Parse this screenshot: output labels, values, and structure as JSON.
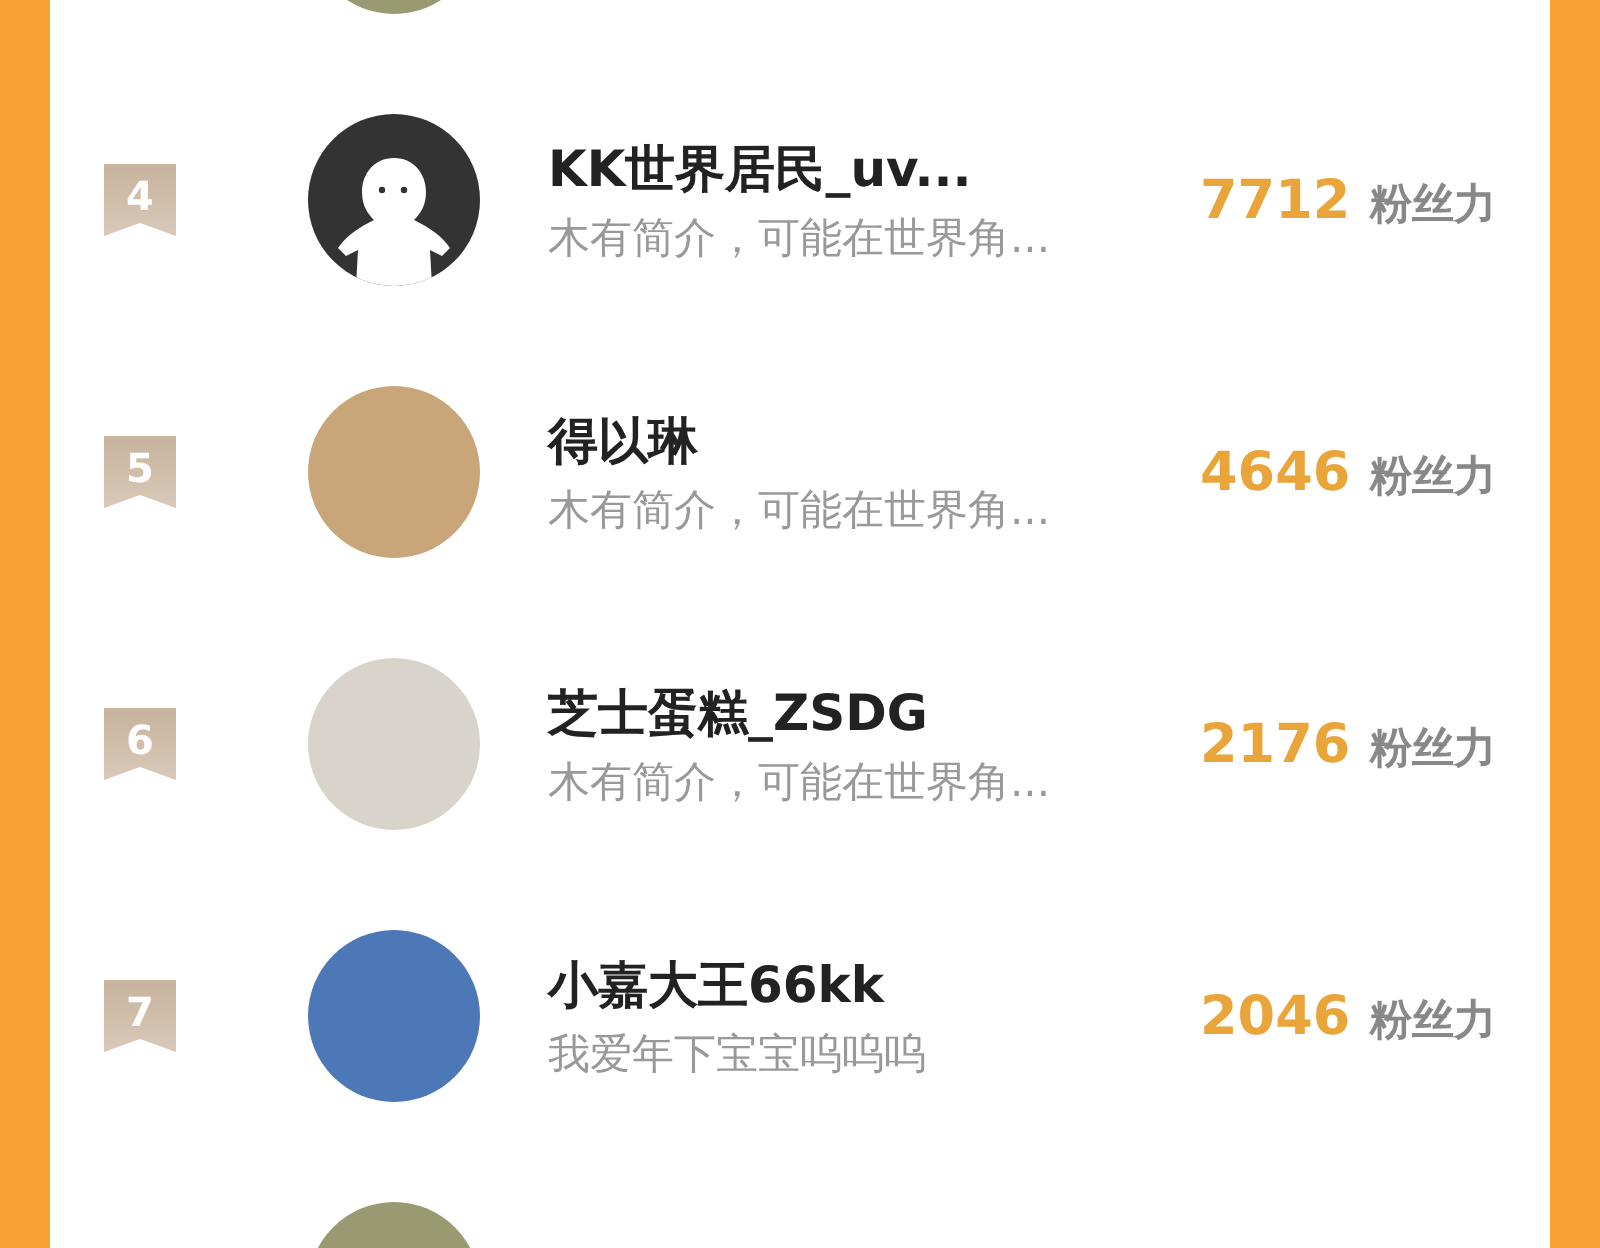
{
  "ranking": [
    {
      "kind": "partial_top",
      "default_avatar": false
    },
    {
      "kind": "full",
      "rank": "4",
      "default_avatar": true,
      "name": "KK世界居民_uv...",
      "bio": "木有简介，可能在世界角...",
      "fans": "7712",
      "fans_label": "粉丝力"
    },
    {
      "kind": "full",
      "rank": "5",
      "default_avatar": false,
      "name": "得以琳",
      "bio": "木有简介，可能在世界角...",
      "fans": "4646",
      "fans_label": "粉丝力"
    },
    {
      "kind": "full",
      "rank": "6",
      "default_avatar": false,
      "name": "芝士蛋糕_ZSDG",
      "bio": "木有简介，可能在世界角...",
      "fans": "2176",
      "fans_label": "粉丝力"
    },
    {
      "kind": "full",
      "rank": "7",
      "default_avatar": false,
      "name": "小嘉大王66kk",
      "bio": "我爱年下宝宝呜呜呜",
      "fans": "2046",
      "fans_label": "粉丝力"
    },
    {
      "kind": "partial_bottom",
      "default_avatar": false
    }
  ]
}
